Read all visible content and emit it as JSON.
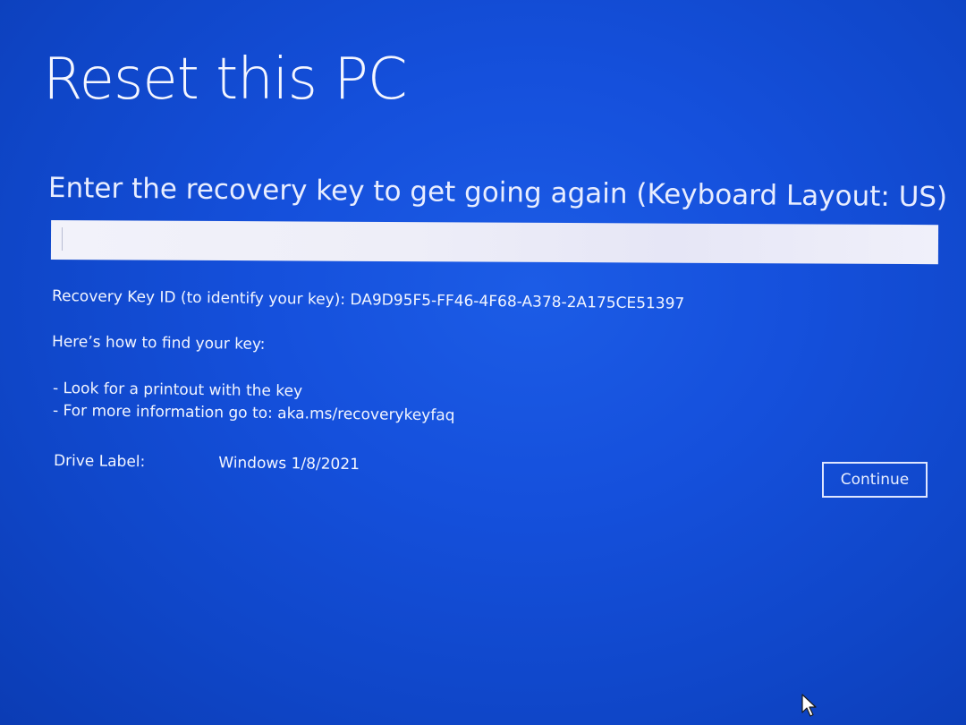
{
  "title": "Reset this PC",
  "prompt": "Enter the recovery key to get going again (Keyboard Layout: US)",
  "recovery_key_input": {
    "value": "",
    "placeholder": ""
  },
  "recovery_key_id": {
    "label": "Recovery Key ID (to identify your key):",
    "value": "DA9D95F5-FF46-4F68-A378-2A175CE51397"
  },
  "help": {
    "heading": "Here’s how to find your key:",
    "items": [
      "- Look for a printout with the key",
      "- For more information go to: aka.ms/recoverykeyfaq"
    ]
  },
  "drive": {
    "label": "Drive Label:",
    "value": "Windows 1/8/2021"
  },
  "continue_label": "Continue",
  "colors": {
    "background": "#1550dc",
    "text": "#ffffff",
    "input_background": "#eeeef8"
  },
  "icons": {
    "cursor": "mouse-pointer-icon"
  }
}
